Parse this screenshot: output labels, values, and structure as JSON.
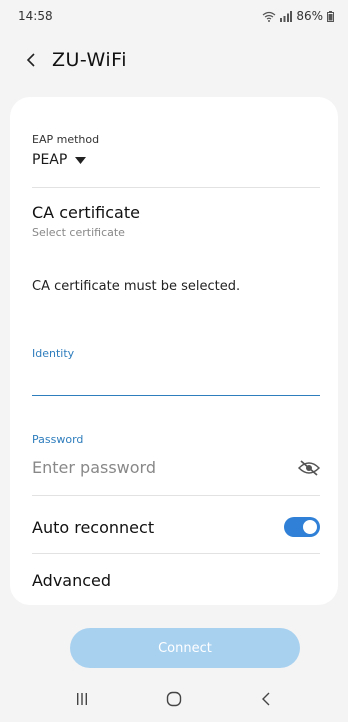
{
  "status_bar": {
    "time": "14:58",
    "battery": "86%"
  },
  "header": {
    "title": "ZU-WiFi"
  },
  "eap": {
    "label": "EAP method",
    "value": "PEAP"
  },
  "ca_certificate": {
    "label": "CA certificate",
    "value": "Select certificate"
  },
  "ca_message": "CA certificate must be selected.",
  "identity": {
    "label": "Identity",
    "value": ""
  },
  "password": {
    "label": "Password",
    "placeholder": "Enter password"
  },
  "auto_reconnect": {
    "label": "Auto reconnect",
    "enabled": true
  },
  "advanced": {
    "label": "Advanced"
  },
  "connect_button": {
    "label": "Connect"
  },
  "colors": {
    "accent": "#2f80d6",
    "button_disabled": "#a8d1f0"
  }
}
